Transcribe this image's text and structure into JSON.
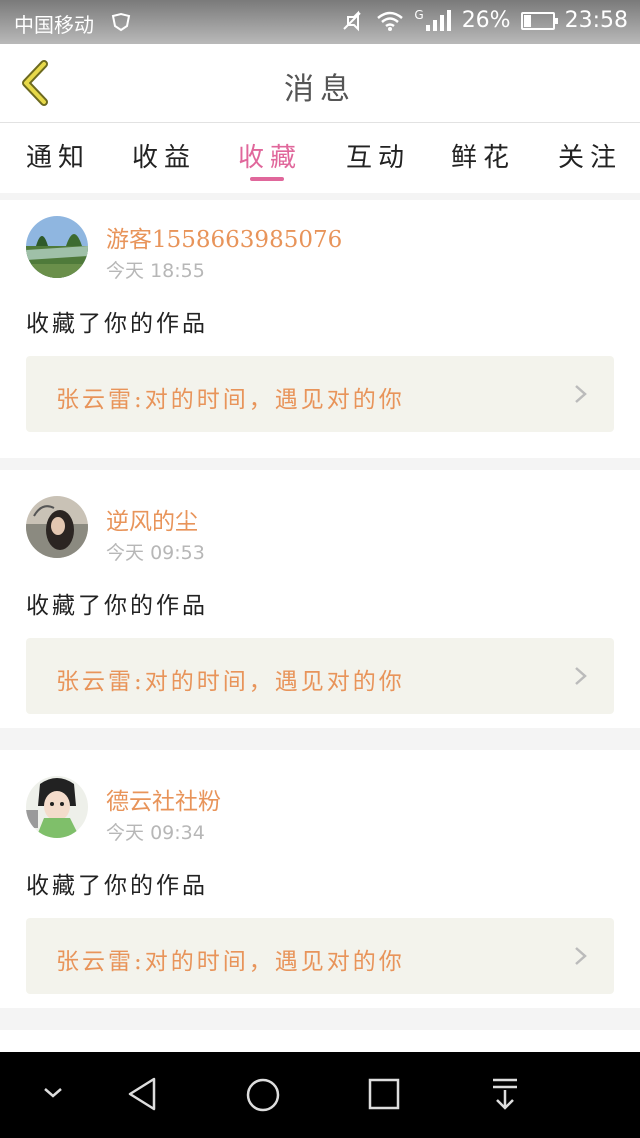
{
  "status_bar": {
    "carrier": "中国移动",
    "network": "G",
    "battery": "26%",
    "battery_level": 0.26,
    "time": "23:58",
    "icons": [
      "hd-icon",
      "mute-icon",
      "wifi-icon",
      "signal-icon",
      "battery-icon"
    ]
  },
  "header": {
    "title": "消息",
    "back_icon": "chevron-left-icon",
    "accent": "#e7d94a"
  },
  "tabs": [
    {
      "label": "通知",
      "active": false
    },
    {
      "label": "收益",
      "active": false
    },
    {
      "label": "收藏",
      "active": true
    },
    {
      "label": "互动",
      "active": false
    },
    {
      "label": "鲜花",
      "active": false
    },
    {
      "label": "关注",
      "active": false
    }
  ],
  "items": [
    {
      "user": "游客1558663985076",
      "time_prefix": "今天",
      "time": "18:55",
      "action": "收藏了你的作品",
      "work": "张云雷:对的时间，遇见对的你"
    },
    {
      "user": "逆风的尘",
      "time_prefix": "今天",
      "time": "09:53",
      "action": "收藏了你的作品",
      "work": "张云雷:对的时间，遇见对的你"
    },
    {
      "user": "德云社社粉",
      "time_prefix": "今天",
      "time": "09:34",
      "action": "收藏了你的作品",
      "work": "张云雷:对的时间，遇见对的你"
    }
  ],
  "colors": {
    "accent_pink": "#e0679b",
    "name_orange": "#e8945a",
    "work_bg": "#f3f3ec"
  },
  "nav": [
    "collapse-icon",
    "back-icon",
    "home-icon",
    "recents-icon",
    "notification-pull-icon"
  ]
}
